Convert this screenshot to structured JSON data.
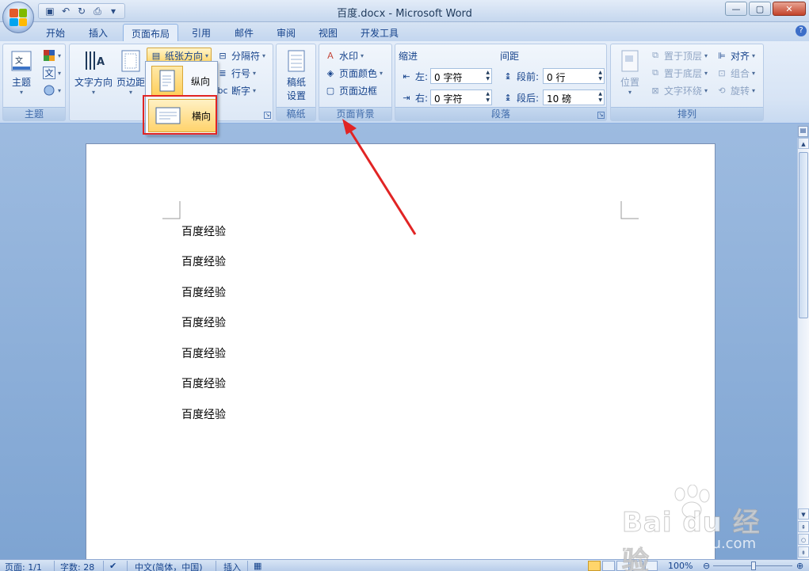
{
  "window": {
    "title": "百度.docx - Microsoft Word"
  },
  "tabs": [
    "开始",
    "插入",
    "页面布局",
    "引用",
    "邮件",
    "审阅",
    "视图",
    "开发工具"
  ],
  "active_tab": "页面布局",
  "ribbon": {
    "theme_group": {
      "label": "主题",
      "theme_btn": "主题"
    },
    "page_setup": {
      "text_direction": "文字方向",
      "margins": "页边距",
      "orientation": "纸张方向",
      "breaks": "分隔符",
      "line_numbers": "行号",
      "hyphenation": "断字"
    },
    "manuscript": {
      "label": "稿纸",
      "btn_line1": "稿纸",
      "btn_line2": "设置"
    },
    "page_background": {
      "label": "页面背景",
      "watermark": "水印",
      "page_color": "页面颜色",
      "page_borders": "页面边框"
    },
    "paragraph": {
      "label": "段落",
      "indent_title": "缩进",
      "spacing_title": "间距",
      "indent_left_label": "左:",
      "indent_left_value": "0 字符",
      "indent_right_label": "右:",
      "indent_right_value": "0 字符",
      "space_before_label": "段前:",
      "space_before_value": "0 行",
      "space_after_label": "段后:",
      "space_after_value": "10 磅"
    },
    "arrange": {
      "label": "排列",
      "position": "位置",
      "bring_front": "置于顶层",
      "send_back": "置于底层",
      "text_wrap": "文字环绕",
      "align": "对齐",
      "group": "组合",
      "rotate": "旋转"
    }
  },
  "orientation_menu": {
    "portrait": "纵向",
    "landscape": "横向"
  },
  "document": {
    "paragraphs": [
      "百度经验",
      "百度经验",
      "百度经验",
      "百度经验",
      "百度经验",
      "百度经验",
      "百度经验"
    ]
  },
  "status": {
    "page": "页面: 1/1",
    "words": "字数: 28",
    "language": "中文(简体，中国)",
    "mode": "插入",
    "zoom": "100%"
  },
  "watermark": {
    "main": "Bai du 经验",
    "sub": "jingyan.baidu.com"
  },
  "colors": {
    "accent": "#15428b",
    "highlight_box": "#e12424",
    "arrow": "#e12424"
  }
}
